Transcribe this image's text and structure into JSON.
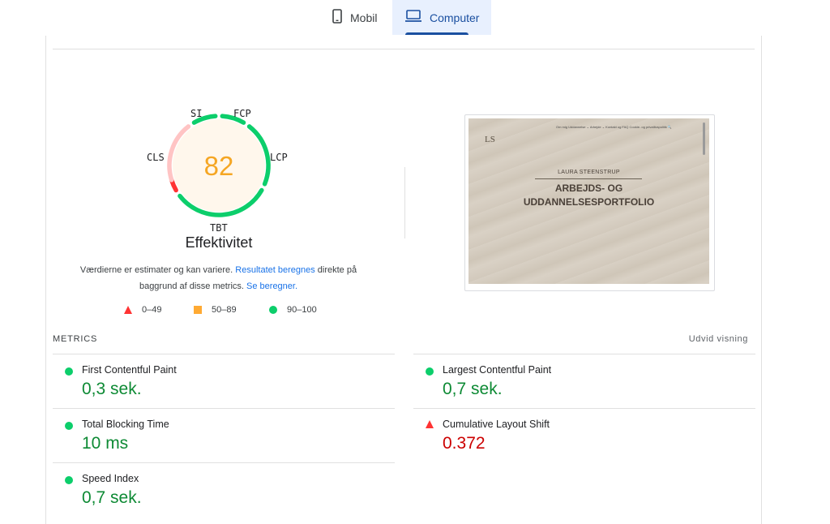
{
  "tabs": [
    {
      "label": "Mobil",
      "icon": "phone-icon",
      "active": false
    },
    {
      "label": "Computer",
      "icon": "laptop-icon",
      "active": true
    }
  ],
  "gauge": {
    "score": "82",
    "title": "Effektivitet",
    "score_color": "#f5a623",
    "labels": {
      "si": "SI",
      "fcp": "FCP",
      "lcp": "LCP",
      "tbt": "TBT",
      "cls": "CLS"
    }
  },
  "note": {
    "text1": "Værdierne er estimater og kan variere. ",
    "link1": "Resultatet beregnes",
    "text2": " direkte på baggrund af disse metrics. ",
    "link2": "Se beregner."
  },
  "legend": [
    {
      "label": "0–49",
      "shape": "triangle",
      "color": "#ff3333"
    },
    {
      "label": "50–89",
      "shape": "square",
      "color": "#ffaa33"
    },
    {
      "label": "90–100",
      "shape": "circle",
      "color": "#0cce6b"
    }
  ],
  "screenshot": {
    "nav": "Om mig   Uddannelse ⌄   Arbejde ⌄   Kontakt og FAQ   Cookie- og privatlivspolitik   🔍",
    "logo": "LS",
    "name": "LAURA STEENSTRUP",
    "headline_1": "ARBEJDS- OG",
    "headline_2": "UDDANNELSESPORTFOLIO"
  },
  "metrics": {
    "header": "METRICS",
    "expand": "Udvid visning",
    "fcp": {
      "name": "First Contentful Paint",
      "value": "0,3 sek.",
      "status": "good"
    },
    "lcp": {
      "name": "Largest Contentful Paint",
      "value": "0,7 sek.",
      "status": "good"
    },
    "tbt": {
      "name": "Total Blocking Time",
      "value": "10 ms",
      "status": "good"
    },
    "cls": {
      "name": "Cumulative Layout Shift",
      "value": "0.372",
      "status": "poor"
    },
    "si": {
      "name": "Speed Index",
      "value": "0,7 sek.",
      "status": "good"
    }
  }
}
